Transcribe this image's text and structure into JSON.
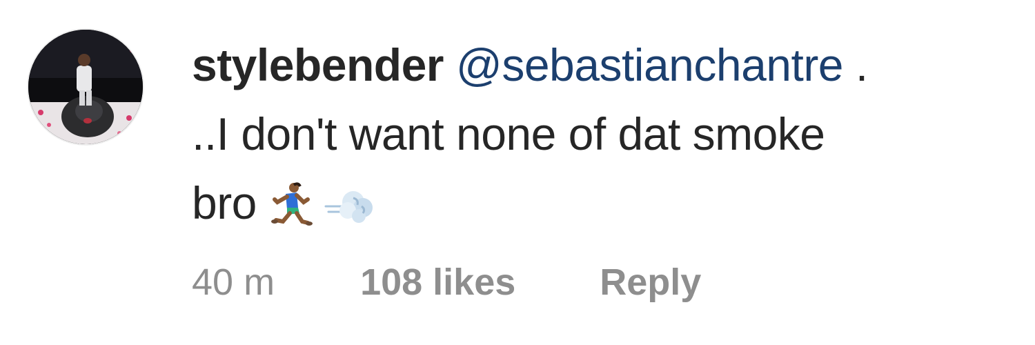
{
  "comment": {
    "username": "stylebender",
    "mention": "@sebastianchantre",
    "after_mention": " .",
    "line2": "..I don't want none of dat smoke",
    "line3": "bro",
    "emojis": [
      "running-man-icon",
      "dash-cloud-icon"
    ],
    "time": "40 m",
    "likes": "108 likes",
    "reply": "Reply"
  },
  "colors": {
    "mention": "#1c3f6e",
    "meta": "#8e8e8e",
    "text": "#262626"
  }
}
